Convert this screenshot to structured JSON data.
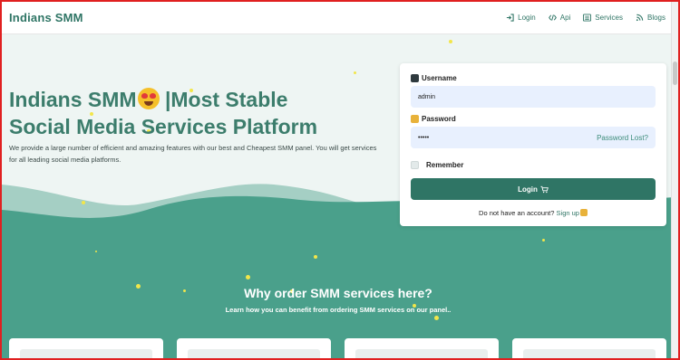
{
  "brand": "Indians SMM",
  "nav": {
    "items": [
      {
        "label": "Login"
      },
      {
        "label": "Api"
      },
      {
        "label": "Services"
      },
      {
        "label": "Blogs"
      }
    ]
  },
  "hero": {
    "title_part1": "Indians SMM",
    "title_part2": " |Most Stable",
    "title_line2": "Social Media Services Platform",
    "description": "We provide a large number of efficient and amazing features with our best and Cheapest SMM panel. You will get services for all leading social media platforms."
  },
  "login": {
    "username_label": "Username",
    "username_value": "admin",
    "password_label": "Password",
    "password_value": "•••••",
    "password_lost": "Password Lost?",
    "remember_label": "Remember",
    "login_button": "Login",
    "no_account": "Do not have an account?",
    "signup_link": "Sign up"
  },
  "why": {
    "title": "Why order SMM services here?",
    "subtitle": "Learn how you can benefit from ordering SMM services on our panel.."
  },
  "colors": {
    "brand": "#2f7565",
    "wave_light": "#a5cfc4",
    "wave_dark": "#4aa08b"
  }
}
